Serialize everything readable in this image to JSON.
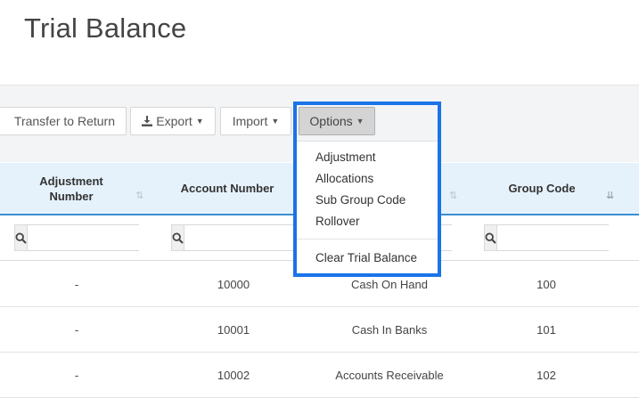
{
  "page": {
    "title": "Trial Balance"
  },
  "toolbar": {
    "transfer_label": "Transfer to Return",
    "export_label": "Export",
    "import_label": "Import",
    "options_label": "Options"
  },
  "options_menu": {
    "items": [
      "Adjustment",
      "Allocations",
      "Sub Group Code",
      "Rollover"
    ],
    "clear_label": "Clear Trial Balance"
  },
  "table": {
    "headers": {
      "adjustment_number": "Adjustment Number",
      "account_number": "Account Number",
      "group_code": "Group Code"
    },
    "rows": [
      {
        "adjustment": "-",
        "account": "10000",
        "description": "Cash On Hand",
        "group": "100"
      },
      {
        "adjustment": "-",
        "account": "10001",
        "description": "Cash In Banks",
        "group": "101"
      },
      {
        "adjustment": "-",
        "account": "10002",
        "description": "Accounts Receivable",
        "group": "102"
      }
    ]
  },
  "colors": {
    "accent": "#1a73e8",
    "header_bg": "#e6f2fb",
    "header_border": "#3b8fd1"
  }
}
